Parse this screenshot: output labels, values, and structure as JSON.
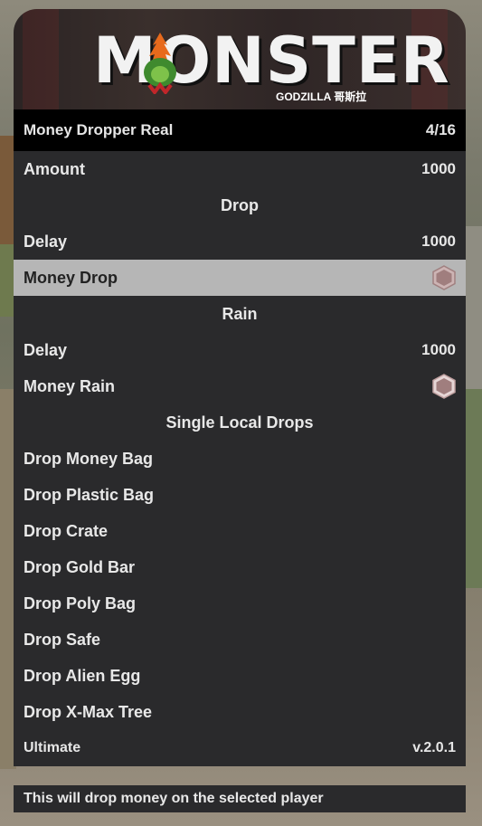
{
  "logo": {
    "text": "MONSTER",
    "subtitle": "GODZILLA 哥斯拉"
  },
  "header": {
    "title": "Money Dropper Real",
    "page": "4/16"
  },
  "rows": [
    {
      "label": "Amount",
      "value": "1000",
      "type": "option"
    },
    {
      "label": "Drop",
      "type": "section"
    },
    {
      "label": "Delay",
      "value": "1000",
      "type": "option"
    },
    {
      "label": "Money Drop",
      "type": "toggle",
      "selected": true
    },
    {
      "label": "Rain",
      "type": "section"
    },
    {
      "label": "Delay",
      "value": "1000",
      "type": "option"
    },
    {
      "label": "Money Rain",
      "type": "toggle"
    },
    {
      "label": "Single Local Drops",
      "type": "section"
    },
    {
      "label": "Drop Money Bag",
      "type": "action"
    },
    {
      "label": "Drop Plastic Bag",
      "type": "action"
    },
    {
      "label": "Drop Crate",
      "type": "action"
    },
    {
      "label": "Drop Gold Bar",
      "type": "action"
    },
    {
      "label": "Drop Poly Bag",
      "type": "action"
    },
    {
      "label": "Drop Safe",
      "type": "action"
    },
    {
      "label": "Drop Alien Egg",
      "type": "action"
    },
    {
      "label": "Drop X-Max Tree",
      "type": "action"
    }
  ],
  "footer": {
    "left": "Ultimate",
    "version": "v.2.0.1"
  },
  "description": "This will drop money on the selected player",
  "colors": {
    "header_bg": "#000000",
    "row_bg": "#2a2a2c",
    "selected_bg": "#b6b6b6",
    "toggle_fill": "#a07e7e"
  },
  "icons": {
    "toggle": "hexagon-toggle-icon"
  }
}
